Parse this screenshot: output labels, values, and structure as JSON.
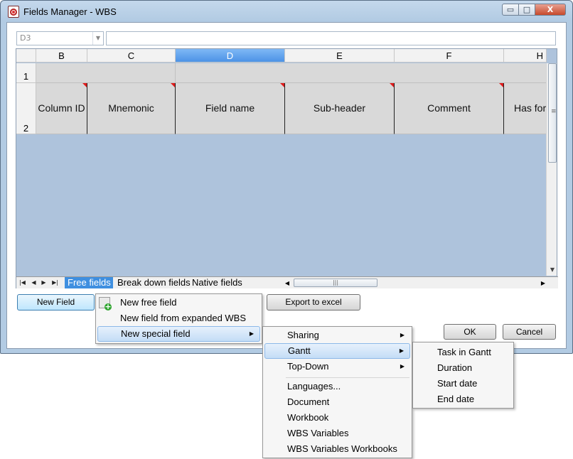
{
  "window": {
    "title": "Fields Manager - WBS",
    "min_glyph": "▭",
    "max_glyph": "□",
    "close_glyph": "X"
  },
  "formula_bar": {
    "cell_ref": "D3",
    "formula": ""
  },
  "grid": {
    "columns": [
      "B",
      "C",
      "D",
      "E",
      "F",
      "H"
    ],
    "selected_column": "D",
    "row_numbers": [
      "1",
      "2"
    ],
    "headers": [
      "Column ID",
      "Mnemonic",
      "Field name",
      "Sub-header",
      "Comment",
      "Has for"
    ]
  },
  "sheet_tabs": [
    "Free fields",
    "Break down fields",
    "Native fields"
  ],
  "buttons": {
    "new_field": "New Field",
    "export": "Export to excel",
    "ok": "OK",
    "cancel": "Cancel"
  },
  "menu_new_field": [
    "New free field",
    "New field from expanded WBS",
    "New special field"
  ],
  "menu_special": [
    "Sharing",
    "Gantt",
    "Top-Down",
    "Languages...",
    "Document",
    "Workbook",
    "WBS Variables",
    "WBS Variables Workbooks"
  ],
  "menu_gantt": [
    "Task in Gantt",
    "Duration",
    "Start date",
    "End date"
  ],
  "icons": {
    "app": "fields-manager-app-icon",
    "submenu": "submenu-arrow-icon",
    "new_field_menu": "add-field-icon"
  },
  "colors": {
    "selection": "#aec3dc",
    "active_tab": "#3f8fe0",
    "marker": "#e01b1b"
  }
}
